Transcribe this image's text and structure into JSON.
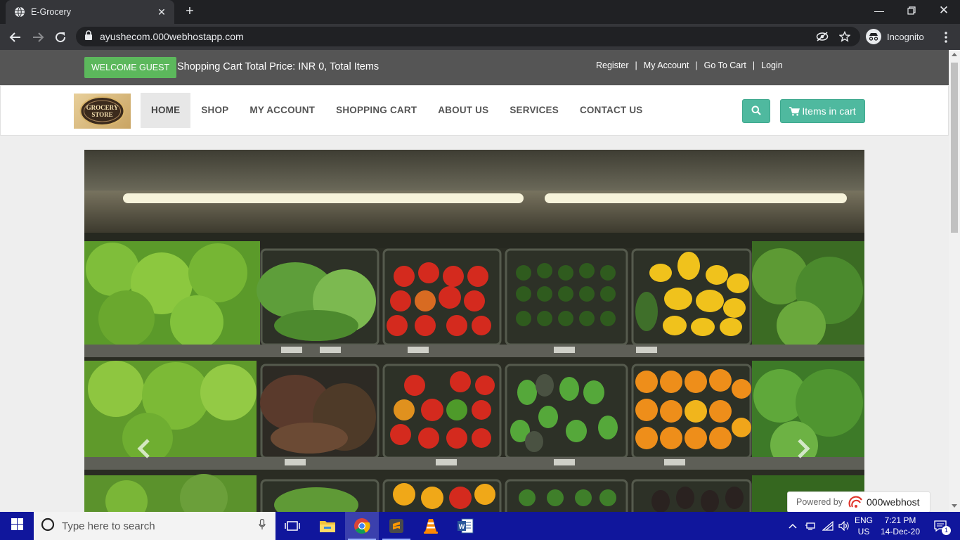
{
  "browser": {
    "tab_title": "E-Grocery",
    "url": "ayushecom.000webhostapp.com",
    "incognito_label": "Incognito"
  },
  "site": {
    "welcome_badge": "WELCOME GUEST",
    "cart_summary": "Shopping Cart Total Price: INR 0, Total Items",
    "top_links": [
      "Register",
      "My Account",
      "Go To Cart",
      "Login"
    ],
    "top_link_separator": "|",
    "logo_alt": "GROCERY STORE",
    "menu": [
      "HOME",
      "SHOP",
      "MY ACCOUNT",
      "SHOPPING CART",
      "ABOUT US",
      "SERVICES",
      "CONTACT US"
    ],
    "active_menu": "HOME",
    "cart_button": "Items in cart",
    "accent_color": "#4fb99f",
    "welcome_color": "#5cb85c"
  },
  "powered_by": {
    "label": "Powered by",
    "brand": "000webhost"
  },
  "taskbar": {
    "search_placeholder": "Type here to search",
    "lang_top": "ENG",
    "lang_bottom": "US",
    "time": "7:21 PM",
    "date": "14-Dec-20",
    "notification_count": "1",
    "pinned": [
      "task-view-icon",
      "file-explorer-icon",
      "chrome-icon",
      "sublime-text-icon",
      "vlc-icon",
      "word-icon"
    ]
  }
}
